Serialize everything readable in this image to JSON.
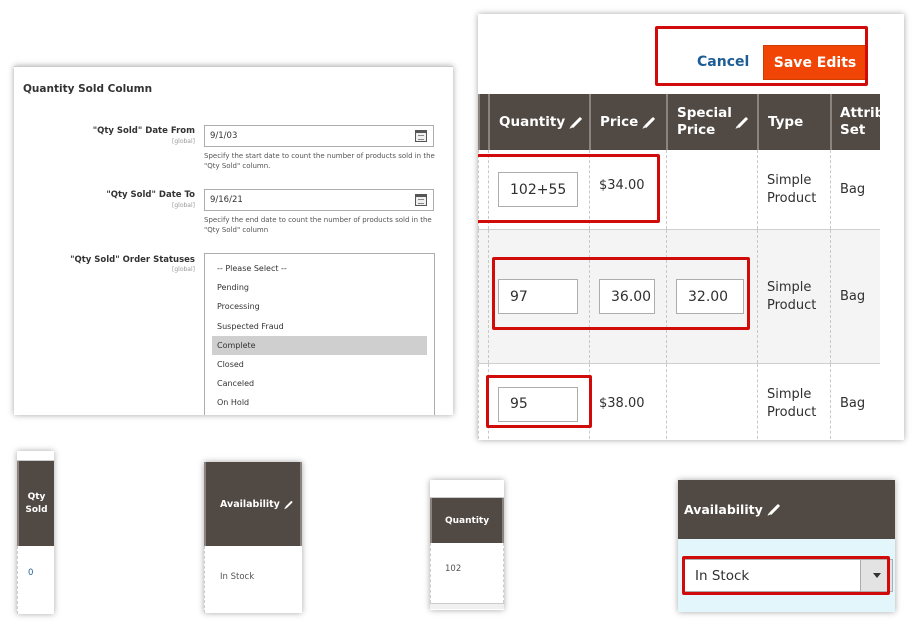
{
  "config": {
    "section_title": "Quantity Sold Column",
    "date_from": {
      "label": "\"Qty Sold\" Date From",
      "scope": "[global]",
      "value": "9/1/03",
      "note": "Specify the start date to count the number of products sold in the \"Qty Sold\" column."
    },
    "date_to": {
      "label": "\"Qty Sold\" Date To",
      "scope": "[global]",
      "value": "9/16/21",
      "note": "Specify the end date to count the number of products sold in the \"Qty Sold\" column"
    },
    "statuses": {
      "label": "\"Qty Sold\" Order Statuses",
      "scope": "[global]",
      "options": [
        "-- Please Select --",
        "Pending",
        "Processing",
        "Suspected Fraud",
        "Complete",
        "Closed",
        "Canceled",
        "On Hold"
      ],
      "selected": "Complete"
    }
  },
  "grid": {
    "cancel_label": "Cancel",
    "save_label": "Save Edits",
    "columns": [
      {
        "label": "Quantity",
        "editable": true
      },
      {
        "label": "Price",
        "editable": true
      },
      {
        "label": "Special Price",
        "editable": true
      },
      {
        "label": "Type",
        "editable": false
      },
      {
        "label": "Attrib Set",
        "editable": false
      }
    ],
    "rows": [
      {
        "quantity": "102+55",
        "price": "$34.00",
        "special_price": "",
        "type": "Simple Product",
        "attribute_set": "Bag"
      },
      {
        "quantity": "97",
        "price": "36.00",
        "special_price": "32.00",
        "type": "Simple Product",
        "attribute_set": "Bag"
      },
      {
        "quantity": "95",
        "price": "$38.00",
        "special_price": "",
        "type": "Simple Product",
        "attribute_set": "Bag"
      }
    ]
  },
  "crops": {
    "qty_sold": {
      "header": "Qty Sold",
      "value": "0"
    },
    "availability": {
      "header": "Availability",
      "value": "In Stock"
    },
    "quantity": {
      "header": "Quantity",
      "value": "102"
    },
    "availability_edit": {
      "header": "Availability",
      "selected": "In Stock"
    }
  },
  "colors": {
    "header_bg": "#514943",
    "save_button": "#f04505",
    "cancel_link": "#1d5d95",
    "highlight": "#d10a0a",
    "editing_row": "#e2f6fc"
  }
}
